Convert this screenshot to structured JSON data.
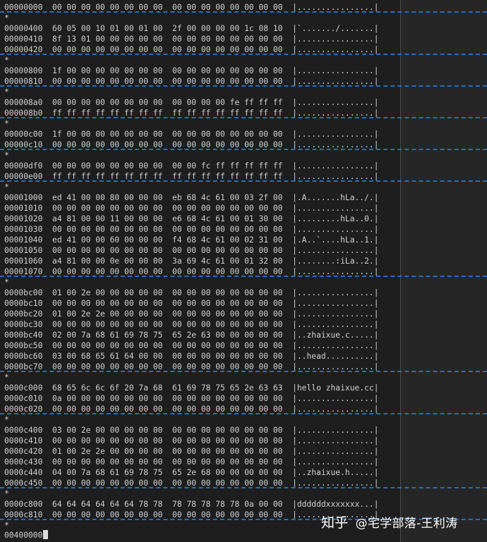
{
  "hexdump": {
    "lines": [
      "00000000  00 00 00 00 00 00 00 00  00 00 00 00 00 00 00 00  |................|",
      "*",
      "00000400  60 05 00 10 01 00 01 00  2f 00 00 00 00 1c 08 10  |`......./.......|",
      "00000410  8f 13 01 00 00 00 00 00  00 00 00 00 00 00 00 00  |................|",
      "00000420  00 00 00 00 00 00 00 00  00 00 00 00 00 00 00 00  |................|",
      "*",
      "00000800  1f 00 00 00 00 00 00 00  00 00 00 00 00 00 00 00  |................|",
      "00000810  00 00 00 00 00 00 00 00  00 00 00 00 00 00 00 00  |................|",
      "*",
      "000008a0  00 00 00 00 00 00 00 00  00 00 00 00 fe ff ff ff  |................|",
      "000008b0  ff ff ff ff ff ff ff ff  ff ff ff ff ff ff ff ff  |................|",
      "*",
      "00000c00  1f 00 00 00 00 00 00 00  00 00 00 00 00 00 00 00  |................|",
      "00000c10  00 00 00 00 00 00 00 00  00 00 00 00 00 00 00 00  |................|",
      "*",
      "00000df0  00 00 00 00 00 00 00 00  00 00 fc ff ff ff ff ff  |................|",
      "00000e00  ff ff ff ff ff ff ff ff  ff ff ff ff ff ff ff ff  |................|",
      "*",
      "00001000  ed 41 00 00 80 00 00 00  eb 68 4c 61 00 03 2f 00  |.A.......hLa../.|",
      "00001010  00 00 00 00 00 00 00 00  00 00 00 00 00 00 00 00  |................|",
      "00001020  a4 81 00 00 11 00 00 00  e6 68 4c 61 00 01 30 00  |.........hLa..0.|",
      "00001030  00 00 00 00 00 00 00 00  00 00 00 00 00 00 00 00  |................|",
      "00001040  ed 41 00 00 60 00 00 00  f4 68 4c 61 00 02 31 00  |.A..`....hLa..1.|",
      "00001050  00 00 00 00 00 00 00 00  00 00 00 00 00 00 00 00  |................|",
      "00001060  a4 81 00 00 0e 00 00 00  3a 69 4c 61 00 01 32 00  |........:iLa..2.|",
      "00001070  00 00 00 00 00 00 00 00  00 00 00 00 00 00 00 00  |................|",
      "*",
      "0000bc00  01 00 2e 00 00 00 00 00  00 00 00 00 00 00 00 00  |................|",
      "0000bc10  00 00 00 00 00 00 00 00  00 00 00 00 00 00 00 00  |................|",
      "0000bc20  01 00 2e 2e 00 00 00 00  00 00 00 00 00 00 00 00  |................|",
      "0000bc30  00 00 00 00 00 00 00 00  00 00 00 00 00 00 00 00  |................|",
      "0000bc40  02 00 7a 68 61 69 78 75  65 2e 63 00 00 00 00 00  |..zhaixue.c.....|",
      "0000bc50  00 00 00 00 00 00 00 00  00 00 00 00 00 00 00 00  |................|",
      "0000bc60  03 00 68 65 61 64 00 00  00 00 00 00 00 00 00 00  |..head..........|",
      "0000bc70  00 00 00 00 00 00 00 00  00 00 00 00 00 00 00 00  |................|",
      "*",
      "0000c000  68 65 6c 6c 6f 20 7a 68  61 69 78 75 65 2e 63 63  |hello zhaixue.cc|",
      "0000c010  0a 00 00 00 00 00 00 00  00 00 00 00 00 00 00 00  |................|",
      "0000c020  00 00 00 00 00 00 00 00  00 00 00 00 00 00 00 00  |................|",
      "*",
      "0000c400  03 00 2e 00 00 00 00 00  00 00 00 00 00 00 00 00  |................|",
      "0000c410  00 00 00 00 00 00 00 00  00 00 00 00 00 00 00 00  |................|",
      "0000c420  01 00 2e 2e 00 00 00 00  00 00 00 00 00 00 00 00  |................|",
      "0000c430  00 00 00 00 00 00 00 00  00 00 00 00 00 00 00 00  |................|",
      "0000c440  04 00 7a 68 61 69 78 75  65 2e 68 00 00 00 00 00  |..zhaixue.h.....|",
      "0000c450  00 00 00 00 00 00 00 00  00 00 00 00 00 00 00 00  |................|",
      "*",
      "0000c800  64 64 64 64 64 64 78 78  78 78 78 78 78 0a 00 00  |ddddddxxxxxxx...|",
      "0000c810  00 00 00 00 00 00 00 00  00 00 00 00 00 00 00 00  |................|",
      "*"
    ],
    "final_offset": "00400000"
  },
  "watermark": {
    "site": "知乎",
    "author": "@宅学部落-王利涛"
  },
  "colors": {
    "background": "#1e1e1e",
    "text": "#d0d0d0",
    "separator_dash": "#1f6fc5"
  }
}
